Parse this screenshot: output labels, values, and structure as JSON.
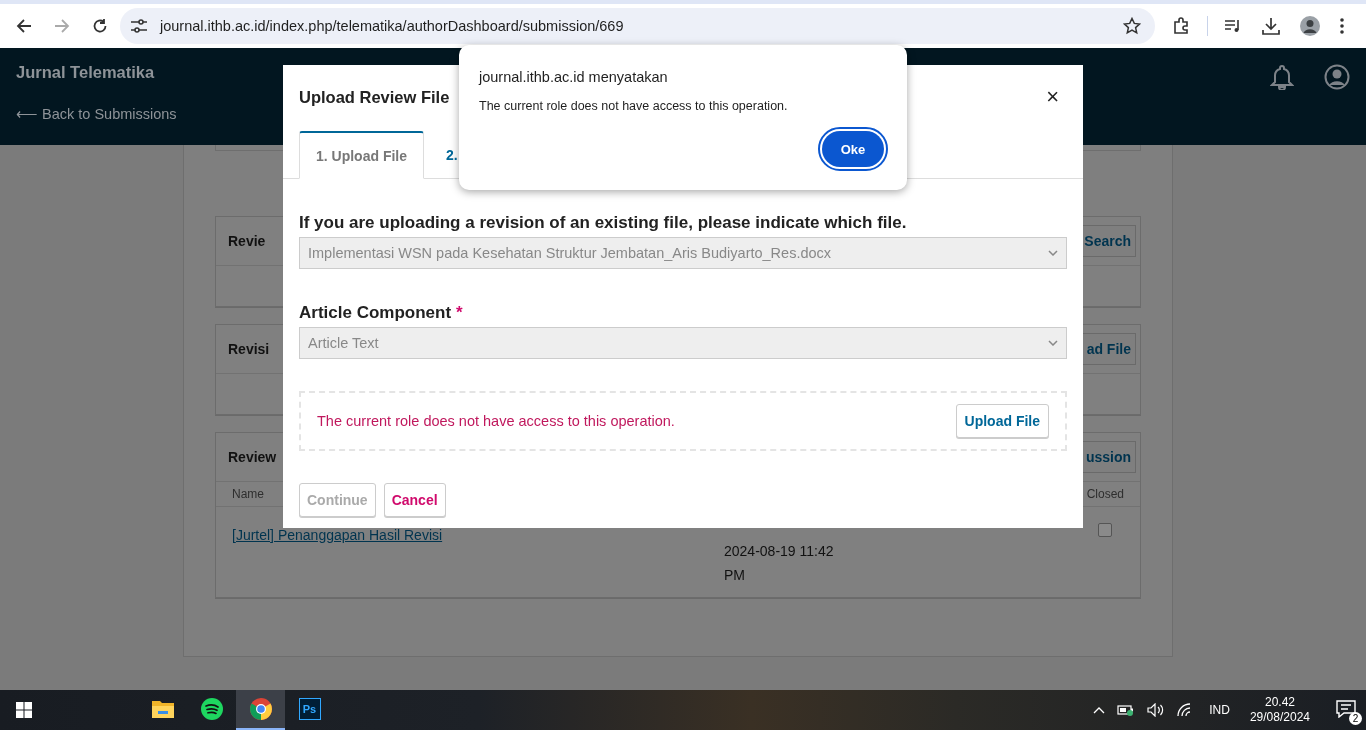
{
  "browser": {
    "nav": [
      {
        "kind": "back",
        "disabled": false
      },
      {
        "kind": "forward",
        "disabled": true
      },
      {
        "kind": "reload",
        "disabled": false
      }
    ],
    "url": "journal.ithb.ac.id/index.php/telematika/authorDashboard/submission/669"
  },
  "header": {
    "site_title": "Jurnal Telematika",
    "back_link": "⟵ Back to Submissions"
  },
  "panels": [
    {
      "title": "Revie",
      "button": "Search"
    },
    {
      "title": "Revisi",
      "button": "ad File"
    },
    {
      "title": "Review",
      "button": "ussion",
      "table": {
        "columns": [
          "Name",
          "Closed"
        ],
        "rows": [
          {
            "link": "[Jurtel] Penanggapan Hasil Revisi",
            "date": "2024-08-19 11:42",
            "time": "PM",
            "closed": false
          }
        ]
      }
    }
  ],
  "dialog": {
    "title": "Upload Review File",
    "close": "×",
    "tabs": [
      {
        "label": "1. Upload File",
        "selected": true
      },
      {
        "label": "2.",
        "selected": false
      }
    ],
    "file_select": {
      "label": "If you are uploading a revision of an existing file, please indicate which file.",
      "value": "Implementasi WSN pada Kesehatan Struktur Jembatan_Aris Budiyarto_Res.docx"
    },
    "component_select": {
      "label": "Article Component",
      "required": true,
      "required_mark": "*",
      "value": "Article Text"
    },
    "upload": {
      "error": "The current role does not have access to this operation.",
      "button": "Upload File"
    },
    "buttons": [
      {
        "label": "Continue",
        "kind": "default",
        "disabled": true
      },
      {
        "label": "Cancel",
        "kind": "danger",
        "disabled": false
      }
    ]
  },
  "alert": {
    "title": "journal.ithb.ac.id menyatakan",
    "message": "The current role does not have access to this operation.",
    "button": "Oke"
  },
  "taskbar": {
    "apps": [
      {
        "kind": "explorer",
        "active": false
      },
      {
        "kind": "spotify",
        "active": false
      },
      {
        "kind": "chrome",
        "active": true
      },
      {
        "kind": "photoshop",
        "label": "Ps",
        "active": false
      }
    ],
    "language": "IND",
    "time": "20.42",
    "date": "29/08/2024",
    "notifications": "2"
  }
}
